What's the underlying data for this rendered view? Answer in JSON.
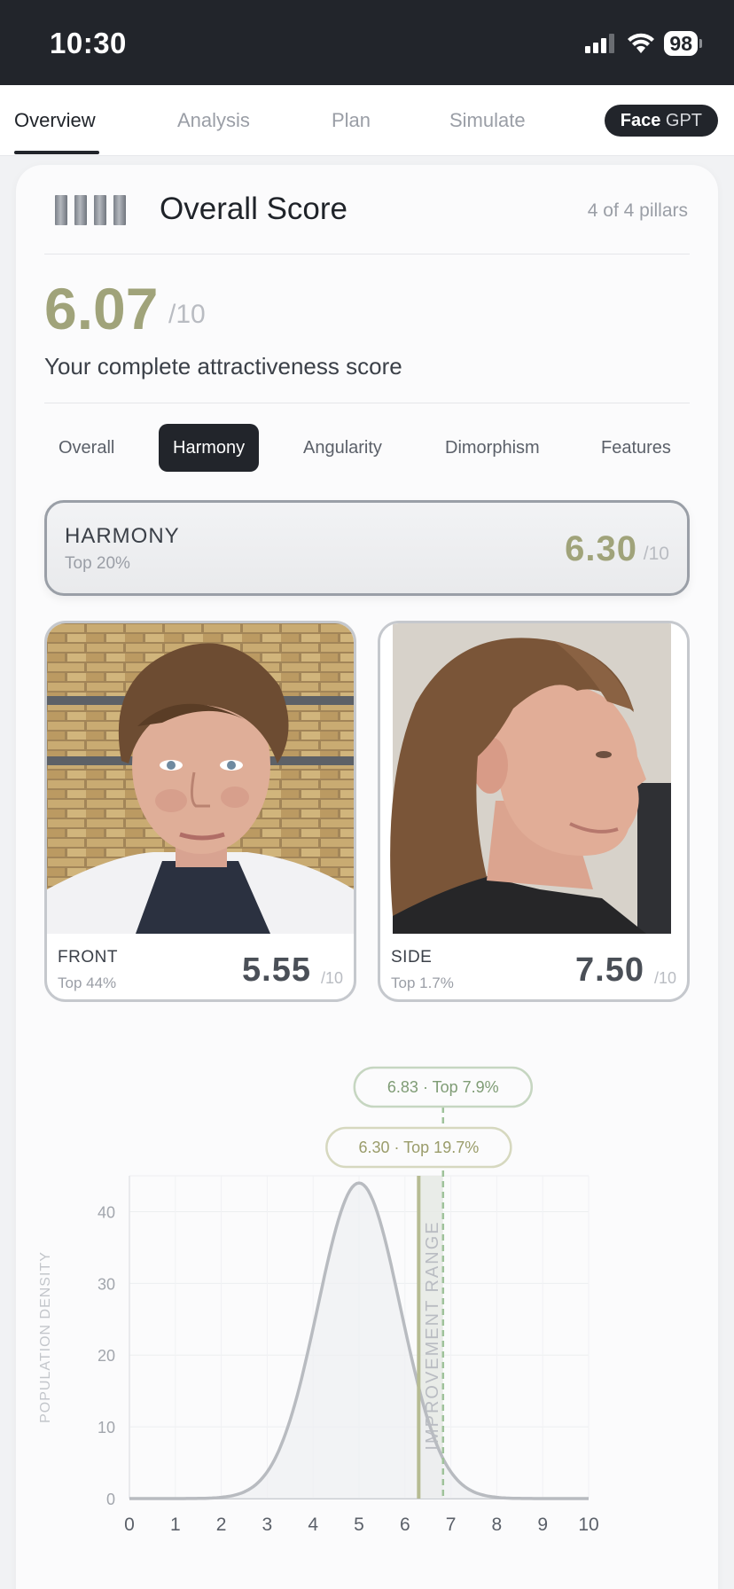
{
  "status_bar": {
    "time": "10:30",
    "battery": "98"
  },
  "nav": {
    "tabs": [
      {
        "label": "Overview",
        "active": true
      },
      {
        "label": "Analysis",
        "active": false
      },
      {
        "label": "Plan",
        "active": false
      },
      {
        "label": "Simulate",
        "active": false
      }
    ],
    "facegpt": {
      "bold": "Face",
      "light": " GPT"
    }
  },
  "overall": {
    "title": "Overall Score",
    "pillars": "4 of 4 pillars",
    "score": "6.07",
    "denom": "/10",
    "subtitle": "Your complete attractiveness score"
  },
  "chips": [
    {
      "label": "Overall",
      "active": false
    },
    {
      "label": "Harmony",
      "active": true
    },
    {
      "label": "Angularity",
      "active": false
    },
    {
      "label": "Dimorphism",
      "active": false
    },
    {
      "label": "Features",
      "active": false
    }
  ],
  "harmony": {
    "title": "HARMONY",
    "top": "Top 20%",
    "score": "6.30",
    "denom": "/10"
  },
  "photos": {
    "front": {
      "label": "FRONT",
      "top": "Top 44%",
      "score": "5.55",
      "denom": "/10"
    },
    "side": {
      "label": "SIDE",
      "top": "Top 1.7%",
      "score": "7.50",
      "denom": "/10"
    }
  },
  "chart_data": {
    "type": "area",
    "ylabel": "POPULATION DENSITY",
    "xlabel": "",
    "xlim": [
      0,
      10
    ],
    "ylim": [
      0,
      45
    ],
    "x_ticks": [
      "0",
      "1",
      "2",
      "3",
      "4",
      "5",
      "6",
      "7",
      "8",
      "9",
      "10"
    ],
    "y_ticks": [
      "0",
      "10",
      "20",
      "30",
      "40"
    ],
    "distribution": {
      "mean": 5.0,
      "sd": 0.9,
      "peak": 44
    },
    "markers": [
      {
        "x": 6.3,
        "label": "6.30 · Top 19.7%",
        "style": "solid",
        "color": "#b6bb92"
      },
      {
        "x": 6.83,
        "label": "6.83 · Top 7.9%",
        "style": "dashed",
        "color": "#9fc29a"
      }
    ],
    "band": {
      "from": 6.3,
      "to": 6.83,
      "label": "IMPROVEMENT RANGE"
    },
    "grid": true
  }
}
